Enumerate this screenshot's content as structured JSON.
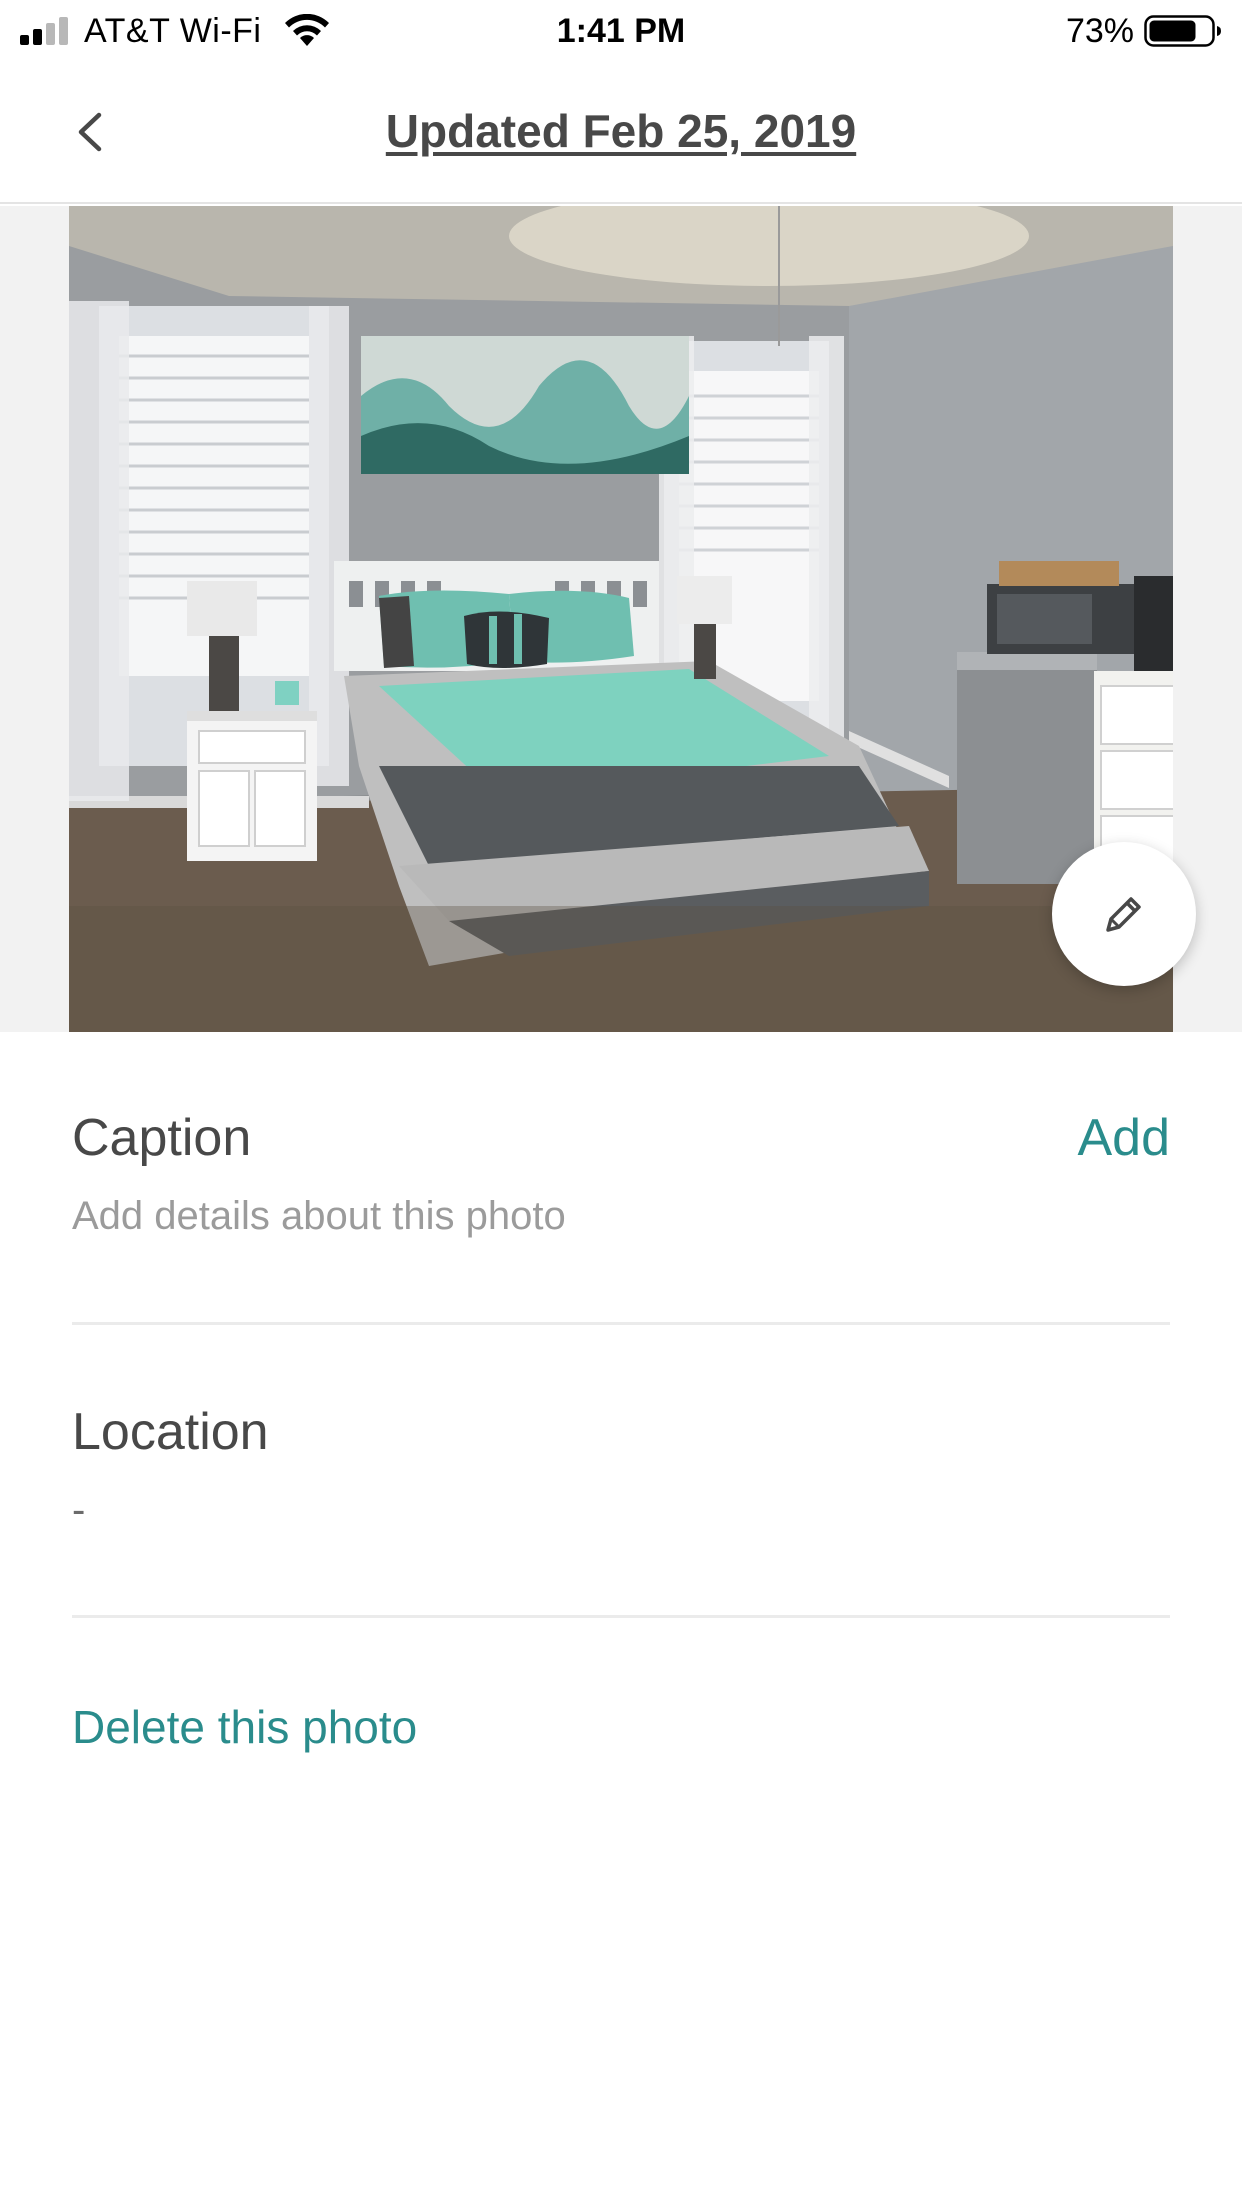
{
  "status_bar": {
    "carrier": "AT&T Wi-Fi",
    "time": "1:41 PM",
    "battery_percent": "73%",
    "battery_level": 0.73,
    "signal_bars": 2,
    "signal_bars_total": 4
  },
  "header": {
    "back_icon": "chevron-left-icon",
    "title": "Updated Feb 25, 2019"
  },
  "photo": {
    "edit_icon": "pencil-icon"
  },
  "caption": {
    "title": "Caption",
    "action": "Add",
    "placeholder": "Add details about this photo"
  },
  "location": {
    "title": "Location",
    "value": "-"
  },
  "delete": {
    "label": "Delete this photo"
  },
  "colors": {
    "accent": "#2a8c8c",
    "text_primary": "#484848",
    "text_secondary": "#9b9b9b"
  }
}
